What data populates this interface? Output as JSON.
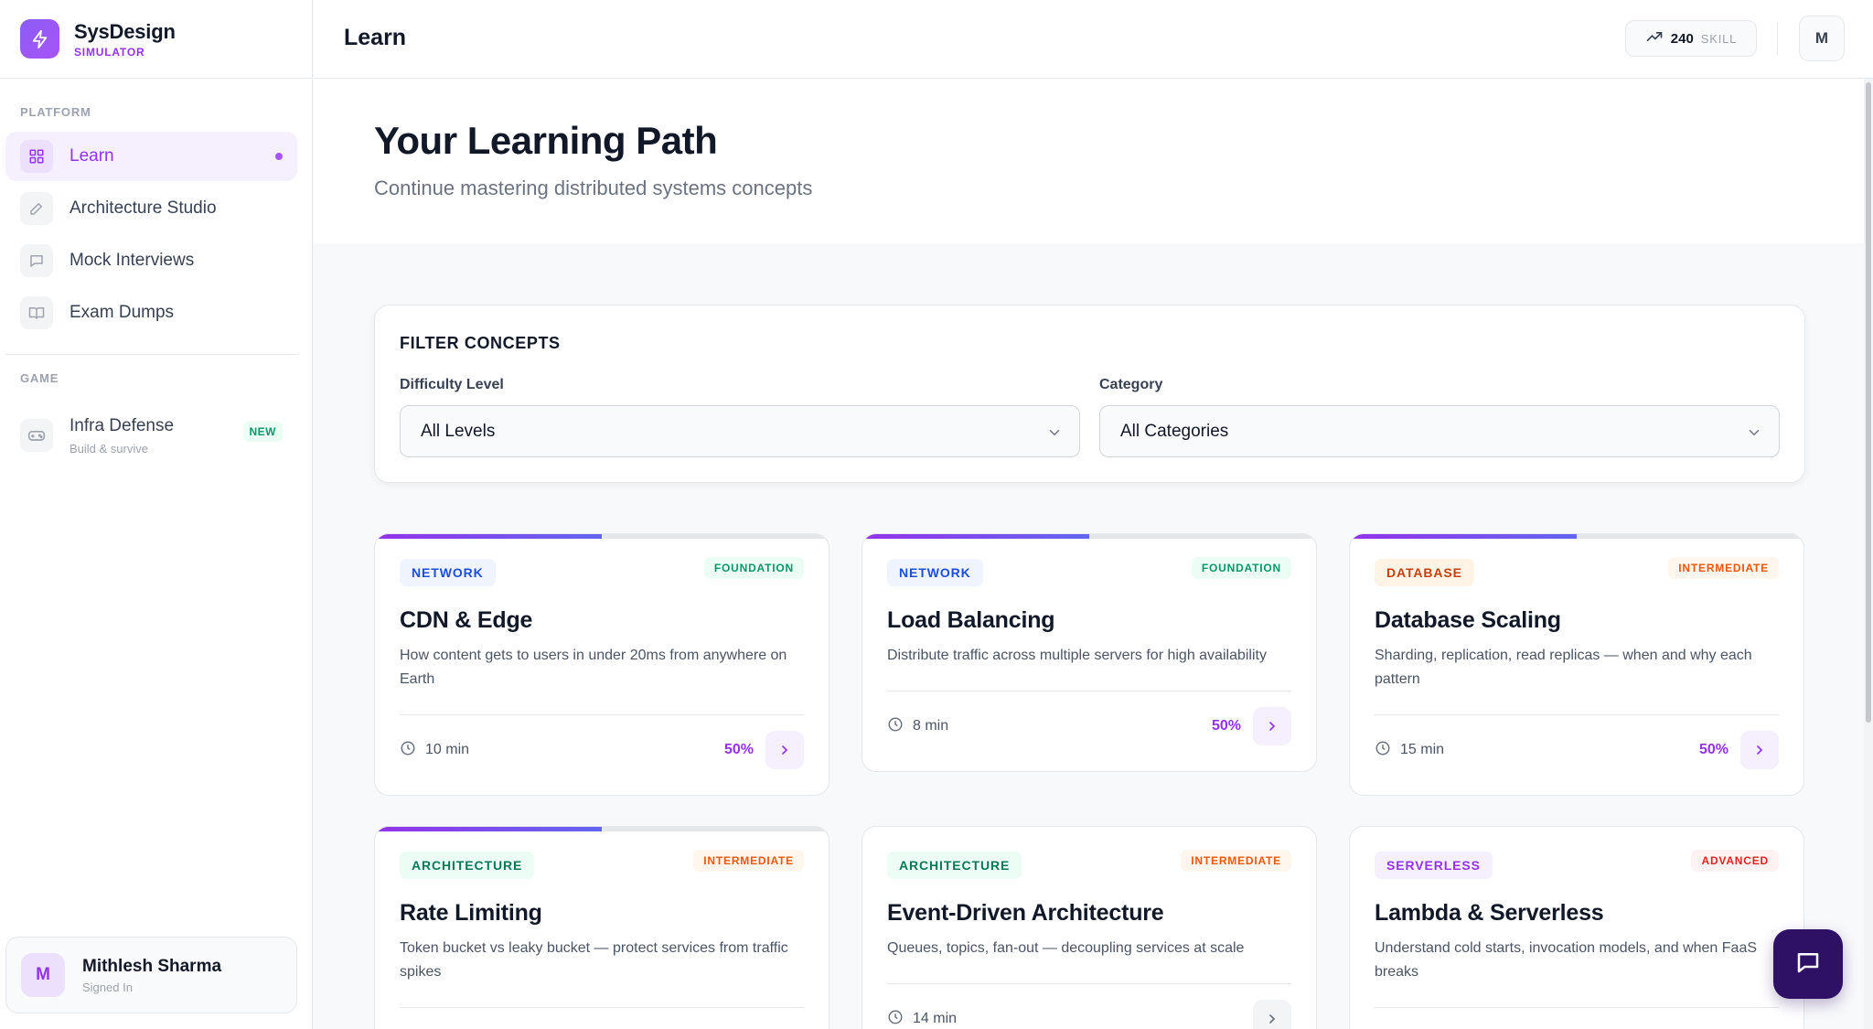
{
  "brand": {
    "name": "SysDesign",
    "sub": "SIMULATOR"
  },
  "sidebar": {
    "platform_label": "PLATFORM",
    "items": [
      {
        "label": "Learn",
        "icon": "grid-icon",
        "active": true
      },
      {
        "label": "Architecture Studio",
        "icon": "pencil-icon"
      },
      {
        "label": "Mock Interviews",
        "icon": "chat-icon"
      },
      {
        "label": "Exam Dumps",
        "icon": "book-icon"
      }
    ],
    "game_label": "GAME",
    "game": {
      "label": "Infra Defense",
      "sub": "Build & survive",
      "badge": "NEW",
      "icon": "gamepad-icon"
    },
    "user": {
      "initial": "M",
      "name": "Mithlesh Sharma",
      "status": "Signed In"
    }
  },
  "header": {
    "title": "Learn",
    "skill_value": "240",
    "skill_label": "SKILL",
    "avatar_initial": "M"
  },
  "hero": {
    "title": "Your Learning Path",
    "subtitle": "Continue mastering distributed systems concepts"
  },
  "filter": {
    "title": "FILTER CONCEPTS",
    "difficulty_label": "Difficulty Level",
    "difficulty_value": "All Levels",
    "category_label": "Category",
    "category_value": "All Categories"
  },
  "cards": [
    {
      "category": "NETWORK",
      "level": "FOUNDATION",
      "title": "CDN & Edge",
      "desc": "How content gets to users in under 20ms from anywhere on Earth",
      "duration": "10 min",
      "progress": "50%",
      "progress_fraction": 0.5
    },
    {
      "category": "NETWORK",
      "level": "FOUNDATION",
      "title": "Load Balancing",
      "desc": "Distribute traffic across multiple servers for high availability",
      "duration": "8 min",
      "progress": "50%",
      "progress_fraction": 0.5
    },
    {
      "category": "DATABASE",
      "level": "INTERMEDIATE",
      "title": "Database Scaling",
      "desc": "Sharding, replication, read replicas — when and why each pattern",
      "duration": "15 min",
      "progress": "50%",
      "progress_fraction": 0.5
    },
    {
      "category": "ARCHITECTURE",
      "level": "INTERMEDIATE",
      "title": "Rate Limiting",
      "desc": "Token bucket vs leaky bucket — protect services from traffic spikes",
      "progress_fraction": 0.5
    },
    {
      "category": "ARCHITECTURE",
      "level": "INTERMEDIATE",
      "title": "Event-Driven Architecture",
      "desc": "Queues, topics, fan-out — decoupling services at scale",
      "duration": "14 min"
    },
    {
      "category": "SERVERLESS",
      "level": "ADVANCED",
      "title": "Lambda & Serverless",
      "desc": "Understand cold starts, invocation models, and when FaaS breaks"
    }
  ],
  "colors": {
    "accent": "#9333ea",
    "chat_button": "#2e1065"
  }
}
